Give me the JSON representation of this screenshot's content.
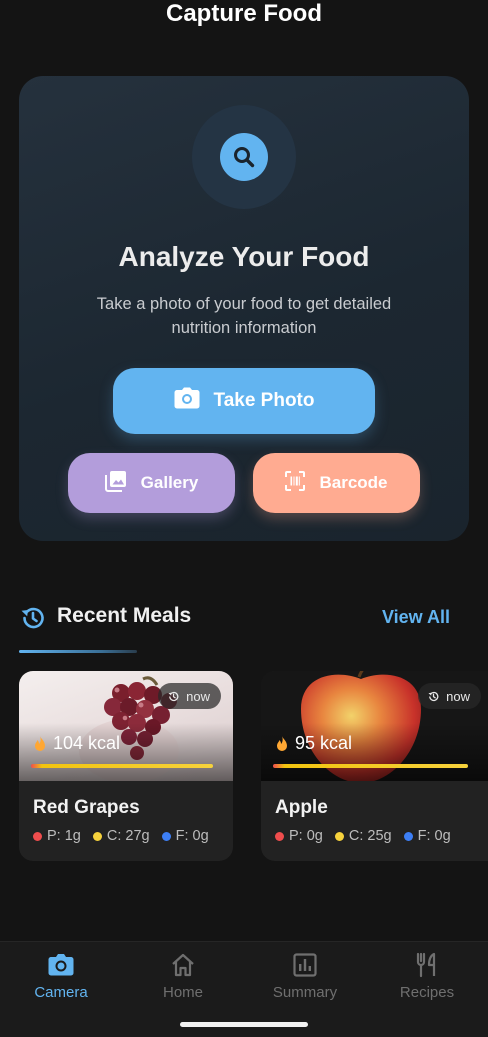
{
  "header": {
    "title": "Capture Food"
  },
  "hero": {
    "heading": "Analyze Your Food",
    "description": "Take a photo of your food to get detailed nutrition information",
    "icon": "search-icon",
    "take_photo_label": "Take Photo",
    "gallery_label": "Gallery",
    "barcode_label": "Barcode"
  },
  "recent": {
    "title": "Recent Meals",
    "view_all_label": "View All",
    "meals": [
      {
        "name": "Red Grapes",
        "time": "now",
        "kcal": "104 kcal",
        "protein": "P: 1g",
        "carbs": "C: 27g",
        "fat": "F: 0g",
        "calorie_fill_fraction": 0.96
      },
      {
        "name": "Apple",
        "time": "now",
        "kcal": "95 kcal",
        "protein": "P: 0g",
        "carbs": "C: 25g",
        "fat": "F: 0g",
        "calorie_fill_fraction": 0.96
      }
    ]
  },
  "nav": {
    "items": [
      {
        "label": "Camera",
        "icon": "camera-icon",
        "active": true
      },
      {
        "label": "Home",
        "icon": "home-icon",
        "active": false
      },
      {
        "label": "Summary",
        "icon": "chart-icon",
        "active": false
      },
      {
        "label": "Recipes",
        "icon": "utensils-icon",
        "active": false
      }
    ]
  },
  "colors": {
    "accent": "#62b4f0",
    "gallery": "#b39ddb",
    "barcode": "#ffab91",
    "protein": "#ef4d4d",
    "carbs": "#f6d23c",
    "fat": "#3d7ff5"
  }
}
